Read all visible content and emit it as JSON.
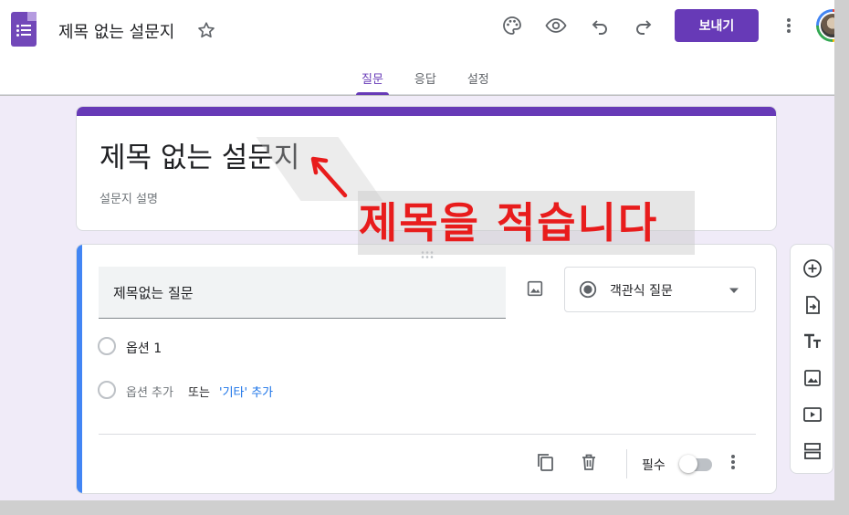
{
  "header": {
    "doc_title": "제목 없는 설문지",
    "send_label": "보내기",
    "icons": [
      "palette-icon",
      "preview-eye-icon",
      "undo-icon",
      "redo-icon",
      "more-vert-icon"
    ]
  },
  "tabs": [
    {
      "label": "질문",
      "active": true
    },
    {
      "label": "응답",
      "active": false
    },
    {
      "label": "설정",
      "active": false
    }
  ],
  "form": {
    "title": "제목 없는 설문지",
    "description_placeholder": "설문지 설명"
  },
  "annotation": {
    "text": "제목을 적습니다",
    "color": "#e81c1c"
  },
  "question": {
    "title": "제목없는 질문",
    "type_label": "객관식 질문",
    "options": [
      "옵션 1"
    ],
    "add_option": "옵션 추가",
    "or_word": "또는",
    "add_other": "'기타' 추가",
    "required_label": "필수",
    "required": false
  },
  "colors": {
    "accent": "#673ab7",
    "question_accent": "#4285f4",
    "background": "#f0ebf8"
  },
  "side_toolbar": [
    "add-question-icon",
    "import-questions-icon",
    "add-title-icon",
    "add-image-icon",
    "add-video-icon",
    "add-section-icon"
  ]
}
